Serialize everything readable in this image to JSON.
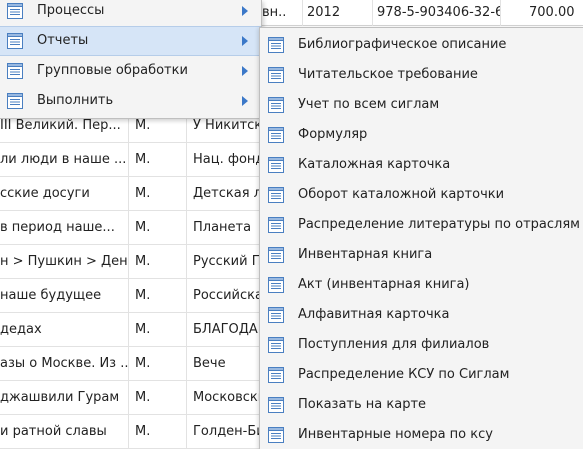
{
  "grid": {
    "top_row": [
      "вн..",
      "2012",
      "978-5-903406-32-6",
      "700.00"
    ],
    "rows": [
      {
        "title": "III Великий. Пер...",
        "city": "М.",
        "publisher": "У Никитск"
      },
      {
        "title": "ли люди в наше ...",
        "city": "М.",
        "publisher": "Нац. фонд"
      },
      {
        "title": "сские досуги",
        "city": "М.",
        "publisher": "Детская ли"
      },
      {
        "title": "в период наше...",
        "city": "М.",
        "publisher": "Планета"
      },
      {
        "title": "н > Пушкин > Ден...",
        "city": "М.",
        "publisher": "Русский П"
      },
      {
        "title": "наше будущее",
        "city": "М.",
        "publisher": "Российска"
      },
      {
        "title": "дедах",
        "city": "М.",
        "publisher": "БЛАГОДАР"
      },
      {
        "title": "азы о Москве. Из ...",
        "city": "М.",
        "publisher": "Вече"
      },
      {
        "title": "джашвили Гурам",
        "city": "М.",
        "publisher": "Московски"
      },
      {
        "title": "и ратной славы",
        "city": "М.",
        "publisher": "Голден-Би"
      }
    ]
  },
  "main_menu": {
    "items": [
      {
        "label": "Процессы",
        "icon": "list-icon"
      },
      {
        "label": "Отчеты",
        "icon": "list-icon",
        "active": true
      },
      {
        "label": "Групповые обработки",
        "icon": "list-icon"
      },
      {
        "label": "Выполнить",
        "icon": "list-icon"
      }
    ]
  },
  "reports_submenu": {
    "items": [
      "Библиографическое описание",
      "Читательское требование",
      "Учет по всем сиглам",
      "Формуляр",
      "Каталожная карточка",
      "Оборот каталожной карточки",
      "Распределение литературы по отраслям",
      "Инвентарная книга",
      "Акт (инвентарная книга)",
      "Алфавитная карточка",
      "Поступления для филиалов",
      "Распределение КСУ по Сиглам",
      "Показать на карте",
      "Инвентарные номера по ксу"
    ]
  },
  "colors": {
    "menu_bg": "#f4f4f4",
    "active_bg": "#d6e5f7",
    "arrow": "#3b78c8",
    "icon_stroke": "#4a7fc1"
  }
}
